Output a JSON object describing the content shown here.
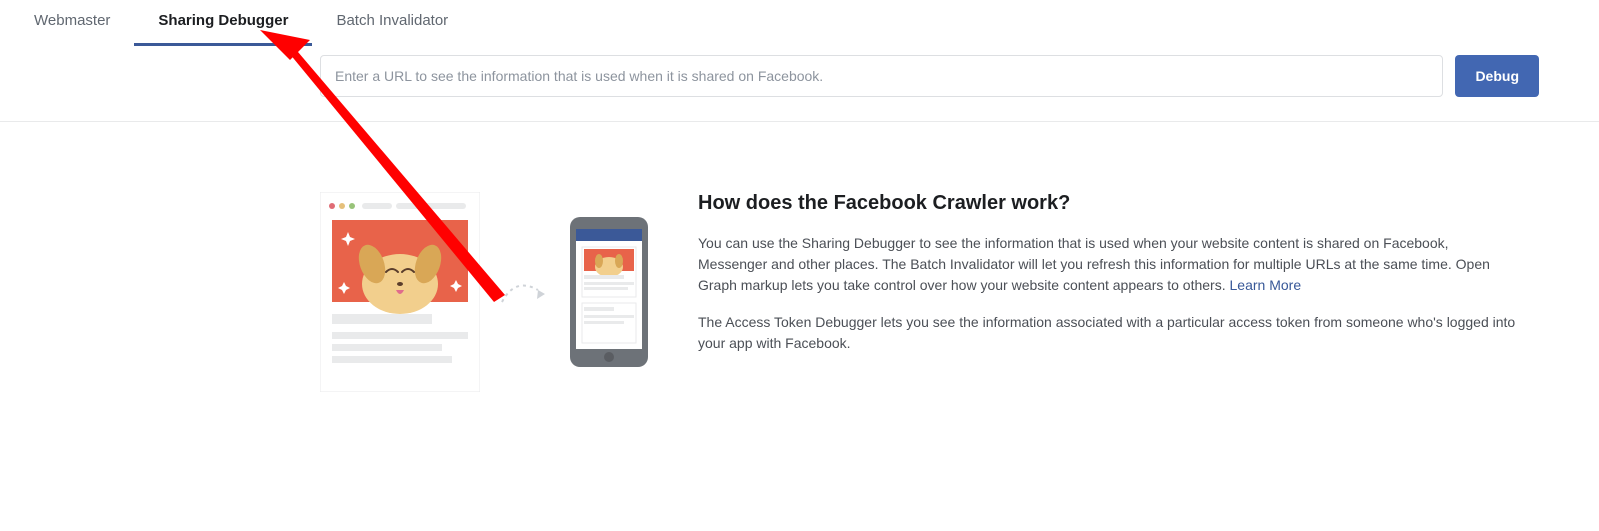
{
  "tabs": {
    "webmaster": "Webmaster",
    "sharing_debugger": "Sharing Debugger",
    "batch_invalidator": "Batch Invalidator"
  },
  "search": {
    "placeholder": "Enter a URL to see the information that is used when it is shared on Facebook.",
    "debug_label": "Debug"
  },
  "info": {
    "heading": "How does the Facebook Crawler work?",
    "para1_before_link": "You can use the Sharing Debugger to see the information that is used when your website content is shared on Facebook, Messenger and other places. The Batch Invalidator will let you refresh this information for multiple URLs at the same time. Open Graph markup lets you take control over how your website content appears to others. ",
    "learn_more": "Learn More",
    "para2": "The Access Token Debugger lets you see the information associated with a particular access token from someone who's logged into your app with Facebook."
  }
}
